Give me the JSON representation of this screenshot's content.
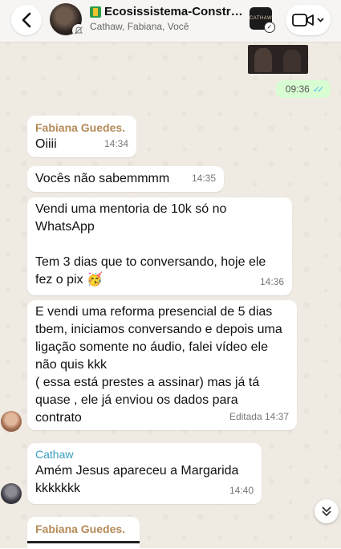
{
  "header": {
    "title": "Ecosissistema-Construin...",
    "participants": "Cathaw, Fabiana, Você",
    "thumb_label": "CATHAW"
  },
  "outgoing": {
    "time": "09:36"
  },
  "messages": [
    {
      "sender": "Fabiana Guedes.",
      "text": "Oiiii",
      "time": "14:34"
    },
    {
      "text": "Vocês não sabemmmm",
      "time": "14:35"
    },
    {
      "text": "Vendi uma mentoria de 10k só no WhatsApp\n\nTem 3 dias que to conversando, hoje ele fez o pix 🥳",
      "time": "14:36"
    },
    {
      "text": "E vendi uma reforma presencial de 5 dias tbem, iniciamos conversando e depois uma ligação somente no áudio, falei vídeo ele não quis kkk\n( essa está prestes a assinar) mas já tá quase , ele já enviou os dados para contrato",
      "time": "Editada 14:37"
    },
    {
      "sender": "Cathaw",
      "text": "Amém Jesus apareceu a Margarida kkkkkkk",
      "time": "14:40"
    },
    {
      "sender": "Fabiana Guedes."
    }
  ],
  "colors": {
    "chat_bg": "#efeae2",
    "outgoing_bubble": "#d9fdd3",
    "fabiana_name": "#b58a58",
    "cathaw_name": "#3a9ec2",
    "read_ticks": "#53bdeb"
  }
}
